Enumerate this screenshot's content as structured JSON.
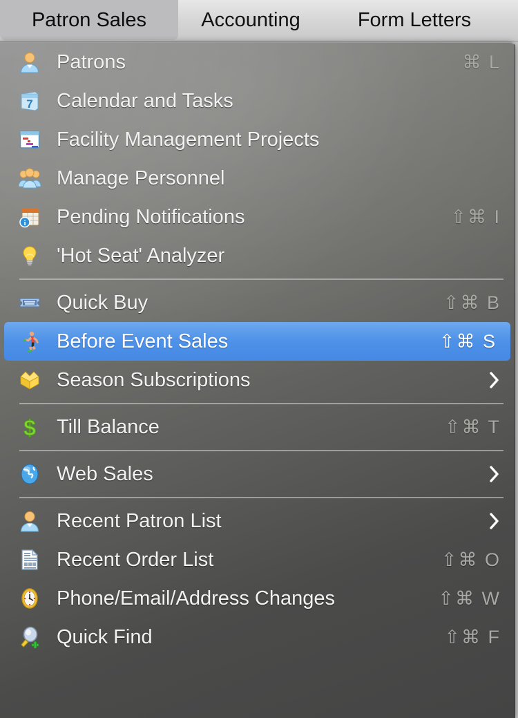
{
  "menubar": {
    "items": [
      {
        "label": "Patron Sales",
        "selected": true
      },
      {
        "label": "Accounting",
        "selected": false
      },
      {
        "label": "Form Letters",
        "selected": false
      }
    ]
  },
  "colors": {
    "highlight_blue": "#4d91e8",
    "menu_text": "#f2f2f2",
    "shortcut_text": "#a9a9a5",
    "separator": "#d7d7d7",
    "menubar_selected_bg": "#bcbcbe"
  },
  "menu": {
    "title": "Patron Sales",
    "rows": [
      {
        "type": "item",
        "icon": "person-icon",
        "label": "Patrons",
        "shortcut": "⌘ L",
        "highlighted": false,
        "submenu": false
      },
      {
        "type": "item",
        "icon": "calendar-icon",
        "label": "Calendar and Tasks",
        "shortcut": "",
        "highlighted": false,
        "submenu": false
      },
      {
        "type": "item",
        "icon": "gantt-chart-icon",
        "label": "Facility Management Projects",
        "shortcut": "",
        "highlighted": false,
        "submenu": false
      },
      {
        "type": "item",
        "icon": "people-group-icon",
        "label": "Manage Personnel",
        "shortcut": "",
        "highlighted": false,
        "submenu": false
      },
      {
        "type": "item",
        "icon": "calendar-info-icon",
        "label": "Pending Notifications",
        "shortcut": "⇧⌘ I",
        "highlighted": false,
        "submenu": false
      },
      {
        "type": "item",
        "icon": "lightbulb-icon",
        "label": "'Hot Seat' Analyzer",
        "shortcut": "",
        "highlighted": false,
        "submenu": false
      },
      {
        "type": "separator"
      },
      {
        "type": "item",
        "icon": "ticket-icon",
        "label": "Quick Buy",
        "shortcut": "⇧⌘ B",
        "highlighted": false,
        "submenu": false
      },
      {
        "type": "item",
        "icon": "running-person-icon",
        "label": "Before Event Sales",
        "shortcut": "⇧⌘ S",
        "highlighted": true,
        "submenu": false
      },
      {
        "type": "item",
        "icon": "gold-box-icon",
        "label": "Season Subscriptions",
        "shortcut": "",
        "highlighted": false,
        "submenu": true
      },
      {
        "type": "separator"
      },
      {
        "type": "item",
        "icon": "dollar-sign-icon",
        "label": "Till Balance",
        "shortcut": "⇧⌘ T",
        "highlighted": false,
        "submenu": false
      },
      {
        "type": "separator"
      },
      {
        "type": "item",
        "icon": "globe-icon",
        "label": "Web Sales",
        "shortcut": "",
        "highlighted": false,
        "submenu": true
      },
      {
        "type": "separator"
      },
      {
        "type": "item",
        "icon": "person-icon",
        "label": "Recent Patron List",
        "shortcut": "",
        "highlighted": false,
        "submenu": true
      },
      {
        "type": "item",
        "icon": "document-icon",
        "label": "Recent Order List",
        "shortcut": "⇧⌘ O",
        "highlighted": false,
        "submenu": false
      },
      {
        "type": "item",
        "icon": "clock-icon",
        "label": "Phone/Email/Address Changes",
        "shortcut": "⇧⌘ W",
        "highlighted": false,
        "submenu": false
      },
      {
        "type": "item",
        "icon": "magnifier-plus-icon",
        "label": "Quick Find",
        "shortcut": "⇧⌘ F",
        "highlighted": false,
        "submenu": false
      }
    ]
  }
}
